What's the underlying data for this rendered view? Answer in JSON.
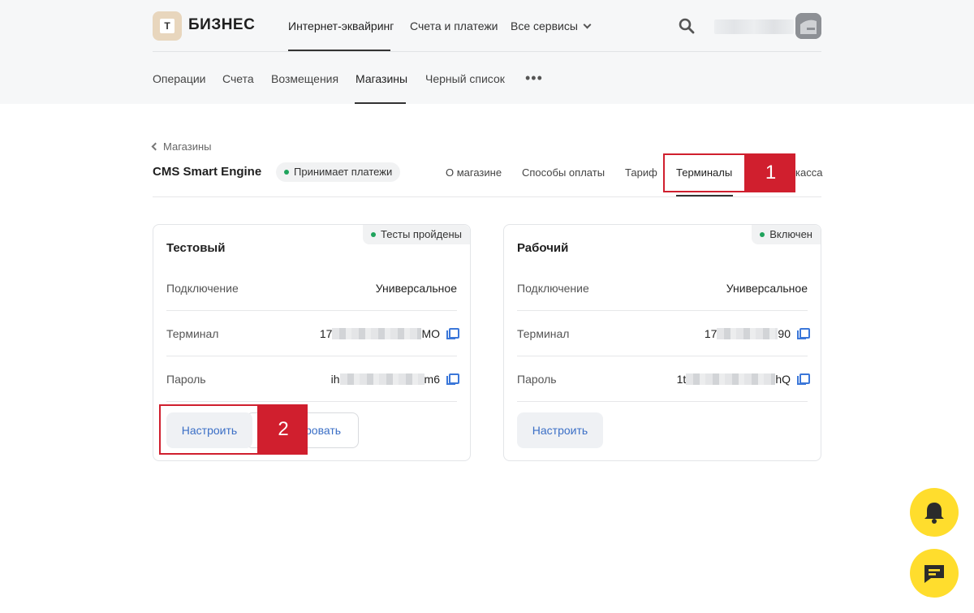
{
  "header": {
    "logo_letter": "Т",
    "brand": "БИЗНЕС",
    "top_nav": [
      {
        "label": "Интернет-эквайринг",
        "active": true
      },
      {
        "label": "Счета и платежи",
        "active": false
      },
      {
        "label": "Все сервисы",
        "active": false
      }
    ],
    "sub_nav": [
      {
        "label": "Операции",
        "active": false
      },
      {
        "label": "Счета",
        "active": false
      },
      {
        "label": "Возмещения",
        "active": false
      },
      {
        "label": "Магазины",
        "active": true
      },
      {
        "label": "Черный список",
        "active": false
      }
    ],
    "more_label": "•••"
  },
  "shop": {
    "back_label": "Магазины",
    "title": "CMS Smart Engine",
    "status": "Принимает платежи",
    "tabs": [
      "О магазине",
      "Способы оплаты",
      "Тариф",
      "Терминалы",
      "касса"
    ],
    "active_tab": "Терминалы"
  },
  "annotations": {
    "label1": "1",
    "label2": "2"
  },
  "cards": [
    {
      "title": "Тестовый",
      "badge": "Тесты пройдены",
      "rows": [
        {
          "label": "Подключение",
          "value": "Универсальное"
        },
        {
          "label": "Терминал",
          "prefix": "17",
          "suffix": "MO"
        },
        {
          "label": "Пароль",
          "prefix": "ih",
          "suffix": "m6"
        }
      ],
      "primary_button": "Настроить",
      "secondary_button": "ровать"
    },
    {
      "title": "Рабочий",
      "badge": "Включен",
      "rows": [
        {
          "label": "Подключение",
          "value": "Универсальное"
        },
        {
          "label": "Терминал",
          "prefix": "17",
          "suffix": "90"
        },
        {
          "label": "Пароль",
          "prefix": "1t",
          "suffix": "hQ"
        }
      ],
      "primary_button": "Настроить"
    }
  ],
  "colors": {
    "accent_red": "#d01f2e",
    "link_blue": "#3b6fc6",
    "status_green": "#1fa35c",
    "fab_yellow": "#ffdd2d"
  },
  "icons": [
    "search-icon",
    "chevron-down-icon",
    "copy-icon",
    "bell-icon",
    "chat-icon",
    "back-chevron-icon"
  ]
}
